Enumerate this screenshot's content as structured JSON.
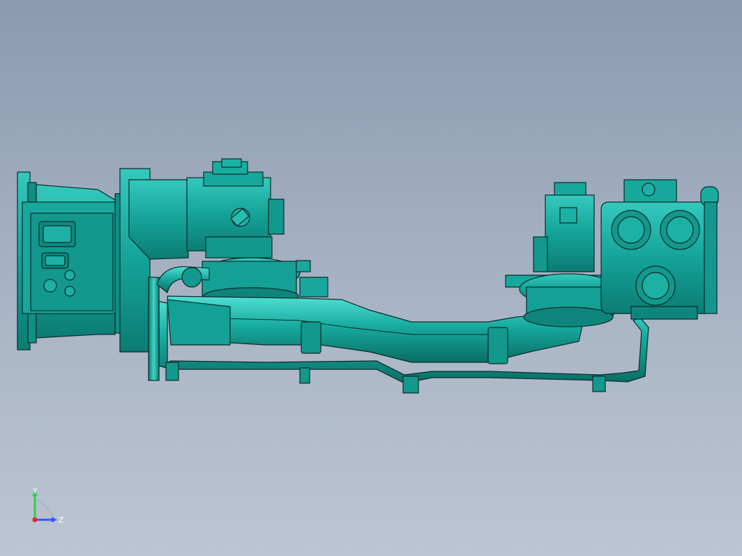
{
  "viewport": {
    "background_top": "#8a9ab0",
    "background_bottom": "#bcc5d3"
  },
  "model": {
    "name_icon": "assembly-3d-model",
    "body_color": "#13a49a",
    "body_light": "#2fc8bc",
    "body_dark": "#0a6a62",
    "edge_color": "#0b2a28"
  },
  "triad": {
    "y_label": "Y",
    "z_label": "Z",
    "y_color": "#2fd04a",
    "z_color": "#2a5cff",
    "x_color": "#e02a2a"
  }
}
